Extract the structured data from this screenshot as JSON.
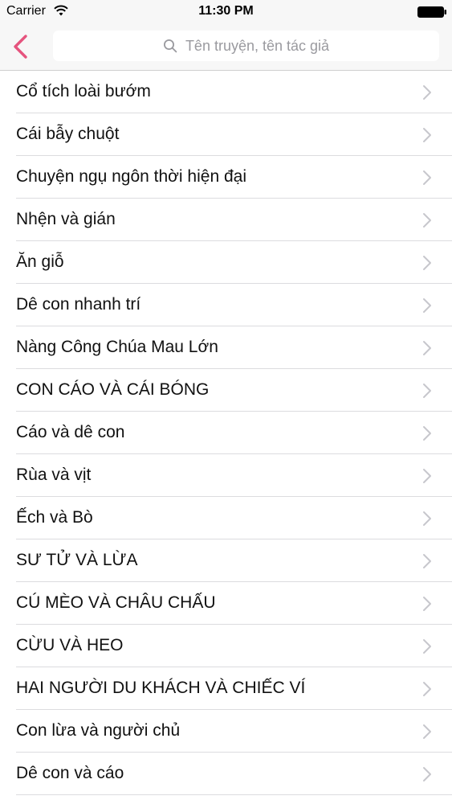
{
  "status_bar": {
    "carrier": "Carrier",
    "time": "11:30 PM"
  },
  "nav": {
    "back_icon": "chevron-left-icon",
    "accent_color": "#e5547e"
  },
  "search": {
    "placeholder": "Tên truyện, tên tác giả",
    "icon": "search-icon"
  },
  "stories": [
    {
      "title": "Cổ tích loài bướm"
    },
    {
      "title": "Cái bẫy chuột"
    },
    {
      "title": "Chuyện ngụ ngôn thời hiện đại"
    },
    {
      "title": "Nhện và gián"
    },
    {
      "title": "Ăn giỗ"
    },
    {
      "title": "Dê con nhanh trí"
    },
    {
      "title": "Nàng Công Chúa Mau Lớn"
    },
    {
      "title": "CON CÁO VÀ CÁI BÓNG"
    },
    {
      "title": "Cáo và dê con"
    },
    {
      "title": "Rùa và vịt"
    },
    {
      "title": "Ếch và Bò"
    },
    {
      "title": "SƯ TỬ VÀ LỪA"
    },
    {
      "title": "CÚ MÈO VÀ CHÂU CHẤU"
    },
    {
      "title": "CỪU VÀ HEO"
    },
    {
      "title": "HAI NGƯỜI DU KHÁCH VÀ CHIẾC VÍ"
    },
    {
      "title": "Con lừa và người chủ"
    },
    {
      "title": "Dê con và cáo"
    }
  ]
}
